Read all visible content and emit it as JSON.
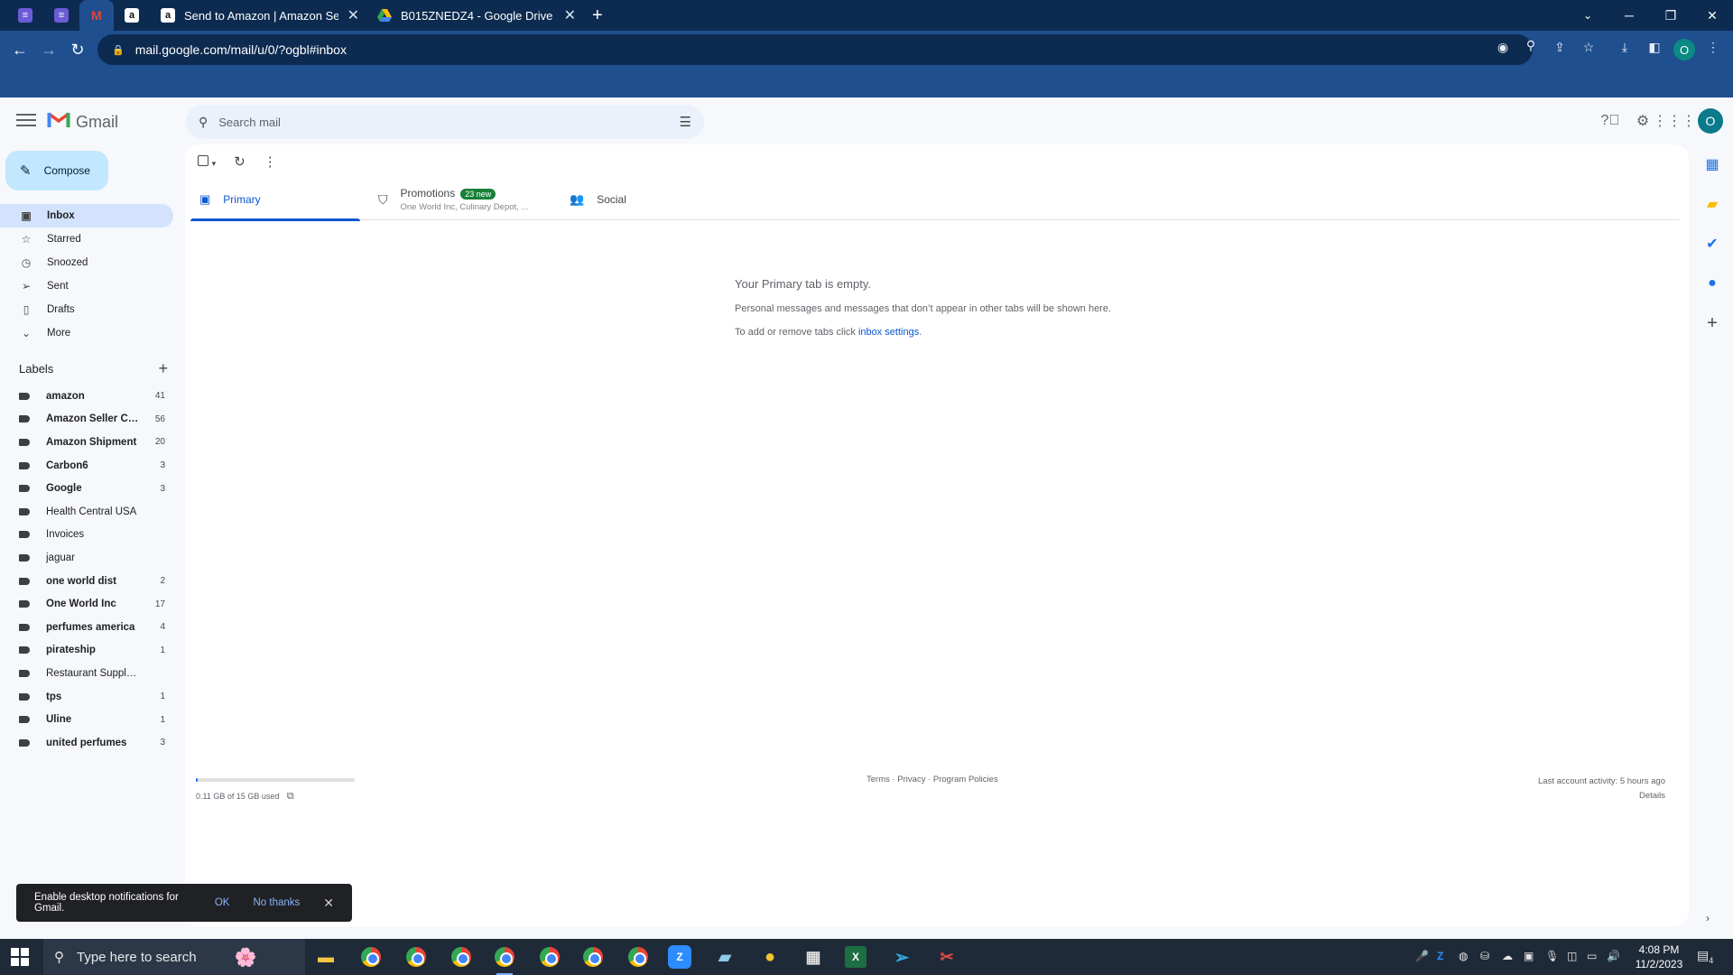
{
  "browser": {
    "tabs": [
      {
        "title": "Send to Amazon | Amazon Seller",
        "close": "✕"
      },
      {
        "title": "B015ZNEDZ4 - Google Drive",
        "close": "✕"
      }
    ],
    "new_tab": "+",
    "url": "mail.google.com/mail/u/0/?ogbl#inbox",
    "profile_initial": "O"
  },
  "gmail": {
    "product_name": "Gmail",
    "search_placeholder": "Search mail",
    "compose_label": "Compose",
    "avatar_initial": "O",
    "nav": [
      {
        "label": "Inbox",
        "icon": "inbox-icon"
      },
      {
        "label": "Starred",
        "icon": "star-icon"
      },
      {
        "label": "Snoozed",
        "icon": "clock-icon"
      },
      {
        "label": "Sent",
        "icon": "send-icon"
      },
      {
        "label": "Drafts",
        "icon": "draft-icon"
      },
      {
        "label": "More",
        "icon": "chevron-down-icon"
      }
    ],
    "labels_heading": "Labels",
    "labels": [
      {
        "name": "amazon",
        "count": "41",
        "bold": true
      },
      {
        "name": "Amazon Seller Ce...",
        "count": "56",
        "bold": true
      },
      {
        "name": "Amazon Shipment",
        "count": "20",
        "bold": true
      },
      {
        "name": "Carbon6",
        "count": "3",
        "bold": true
      },
      {
        "name": "Google",
        "count": "3",
        "bold": true
      },
      {
        "name": "Health Central USA",
        "count": "",
        "bold": false
      },
      {
        "name": "Invoices",
        "count": "",
        "bold": false
      },
      {
        "name": "jaguar",
        "count": "",
        "bold": false
      },
      {
        "name": "one world dist",
        "count": "2",
        "bold": true
      },
      {
        "name": "One World Inc",
        "count": "17",
        "bold": true
      },
      {
        "name": "perfumes america",
        "count": "4",
        "bold": true
      },
      {
        "name": "pirateship",
        "count": "1",
        "bold": true
      },
      {
        "name": "Restaurant Supply D",
        "count": "",
        "bold": false
      },
      {
        "name": "tps",
        "count": "1",
        "bold": true
      },
      {
        "name": "Uline",
        "count": "1",
        "bold": true
      },
      {
        "name": "united perfumes",
        "count": "3",
        "bold": true
      }
    ],
    "tabs": {
      "primary": "Primary",
      "promotions": "Promotions",
      "promotions_badge": "23 new",
      "promotions_sub": "One World Inc, Culinary Depot, ...",
      "social": "Social"
    },
    "empty_state": {
      "heading": "Your Primary tab is empty.",
      "line1": "Personal messages and messages that don’t appear in other tabs will be shown here.",
      "line2_prefix": "To add or remove tabs click ",
      "line2_link": "inbox settings",
      "line2_suffix": "."
    },
    "storage": {
      "text": "0.11 GB of 15 GB used",
      "fraction": 0.007
    },
    "footer_links": "Terms · Privacy · Program Policies",
    "last_activity": "Last account activity: 5 hours ago",
    "details": "Details",
    "notification": {
      "message": "Enable desktop notifications for Gmail.",
      "ok": "OK",
      "no_thanks": "No thanks"
    }
  },
  "taskbar": {
    "search_placeholder": "Type here to search",
    "time": "4:08 PM",
    "date": "11/2/2023",
    "notif_count": "4"
  }
}
